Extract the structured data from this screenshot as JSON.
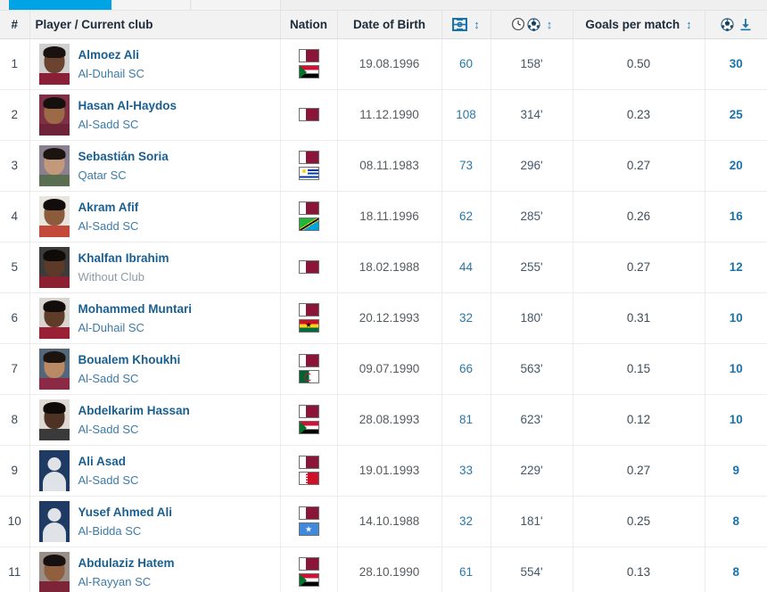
{
  "tabstrip": {
    "active_tab": "",
    "tab2": "",
    "tab3": ""
  },
  "table": {
    "headers": {
      "rank": "#",
      "player": "Player / Current club",
      "nation": "Nation",
      "dob": "Date of Birth",
      "appearances_icon": "pitch-icon",
      "minutes_per_goal_icon": "clock-ball-icon",
      "goals_per_match": "Goals per match",
      "goals_icon": "ball-icon",
      "sort_glyph": "↕",
      "download_glyph": "↓"
    },
    "colors": {
      "link_blue": "#1a5f8f",
      "club_blue": "#3c7ba8",
      "value_blue": "#2a77a8",
      "goals_blue": "#1a74ab",
      "header_navy": "#1b2b3a",
      "header_bg": "#f2f2f2",
      "tab_active": "#00a3e4",
      "qatar_maroon": "#8a1538"
    },
    "rows": [
      {
        "rank": "1",
        "name": "Almoez Ali",
        "club": "Al-Duhail SC",
        "club_state": "club",
        "flags": [
          "qa",
          "sd"
        ],
        "dob": "19.08.1996",
        "apps": "60",
        "mpg": "158'",
        "gpm": "0.50",
        "goals": "30",
        "avatar": "photo",
        "hair": "#1a1210",
        "skin": "#6b4430",
        "bg": "#cfcfcf",
        "shirt": "#8a1f38"
      },
      {
        "rank": "2",
        "name": "Hasan Al-Haydos",
        "club": "Al-Sadd SC",
        "club_state": "club",
        "flags": [
          "qa"
        ],
        "dob": "11.12.1990",
        "apps": "108",
        "mpg": "314'",
        "gpm": "0.23",
        "goals": "25",
        "avatar": "photo",
        "hair": "#15100e",
        "skin": "#9c6a47",
        "bg": "#7e3045",
        "shirt": "#6d2338"
      },
      {
        "rank": "3",
        "name": "Sebastián Soria",
        "club": "Qatar SC",
        "club_state": "club",
        "flags": [
          "qa",
          "uy"
        ],
        "dob": "08.11.1983",
        "apps": "73",
        "mpg": "296'",
        "gpm": "0.27",
        "goals": "20",
        "avatar": "photo",
        "hair": "#1c1410",
        "skin": "#c2997a",
        "bg": "#8a7f8e",
        "shirt": "#5a6f52"
      },
      {
        "rank": "4",
        "name": "Akram Afif",
        "club": "Al-Sadd SC",
        "club_state": "club",
        "flags": [
          "qa",
          "tz"
        ],
        "dob": "18.11.1996",
        "apps": "62",
        "mpg": "285'",
        "gpm": "0.26",
        "goals": "16",
        "avatar": "photo",
        "hair": "#120d0b",
        "skin": "#8a5c3c",
        "bg": "#e8e4de",
        "shirt": "#c24a3a"
      },
      {
        "rank": "5",
        "name": "Khalfan Ibrahim",
        "club": "Without Club",
        "club_state": "none",
        "flags": [
          "qa"
        ],
        "dob": "18.02.1988",
        "apps": "44",
        "mpg": "255'",
        "gpm": "0.27",
        "goals": "12",
        "avatar": "photo",
        "hair": "#0f0b09",
        "skin": "#5c3a27",
        "bg": "#3b3b3b",
        "shirt": "#8c2030"
      },
      {
        "rank": "6",
        "name": "Mohammed Muntari",
        "club": "Al-Duhail SC",
        "club_state": "club",
        "flags": [
          "qa",
          "gh"
        ],
        "dob": "20.12.1993",
        "apps": "32",
        "mpg": "180'",
        "gpm": "0.31",
        "goals": "10",
        "avatar": "photo",
        "hair": "#120c0a",
        "skin": "#5e3c28",
        "bg": "#d8d4cf",
        "shirt": "#9a2135"
      },
      {
        "rank": "7",
        "name": "Boualem Khoukhi",
        "club": "Al-Sadd SC",
        "club_state": "club",
        "flags": [
          "qa",
          "dz"
        ],
        "dob": "09.07.1990",
        "apps": "66",
        "mpg": "563'",
        "gpm": "0.15",
        "goals": "10",
        "avatar": "photo",
        "hair": "#1d1410",
        "skin": "#b98a63",
        "bg": "#54667a",
        "shirt": "#8c2a46"
      },
      {
        "rank": "8",
        "name": "Abdelkarim Hassan",
        "club": "Al-Sadd SC",
        "club_state": "club",
        "flags": [
          "qa",
          "sd"
        ],
        "dob": "28.08.1993",
        "apps": "81",
        "mpg": "623'",
        "gpm": "0.12",
        "goals": "10",
        "avatar": "photo",
        "hair": "#0f0a08",
        "skin": "#4e3224",
        "bg": "#ded9d3",
        "shirt": "#3a3a3a"
      },
      {
        "rank": "9",
        "name": "Ali Asad",
        "club": "Al-Sadd SC",
        "club_state": "club",
        "flags": [
          "qa",
          "bh"
        ],
        "dob": "19.01.1993",
        "apps": "33",
        "mpg": "229'",
        "gpm": "0.27",
        "goals": "9",
        "avatar": "placeholder",
        "hair": "",
        "skin": "",
        "bg": "#1f3b63",
        "shirt": ""
      },
      {
        "rank": "10",
        "name": "Yusef Ahmed Ali",
        "club": "Al-Bidda SC",
        "club_state": "club",
        "flags": [
          "qa",
          "so"
        ],
        "dob": "14.10.1988",
        "apps": "32",
        "mpg": "181'",
        "gpm": "0.25",
        "goals": "8",
        "avatar": "placeholder",
        "hair": "",
        "skin": "",
        "bg": "#1f3b63",
        "shirt": ""
      },
      {
        "rank": "11",
        "name": "Abdulaziz Hatem",
        "club": "Al-Rayyan SC",
        "club_state": "club",
        "flags": [
          "qa",
          "sd"
        ],
        "dob": "28.10.1990",
        "apps": "61",
        "mpg": "554'",
        "gpm": "0.13",
        "goals": "8",
        "avatar": "photo",
        "hair": "#171010",
        "skin": "#8f5f40",
        "bg": "#9a8f86",
        "shirt": "#7e2438"
      }
    ]
  }
}
